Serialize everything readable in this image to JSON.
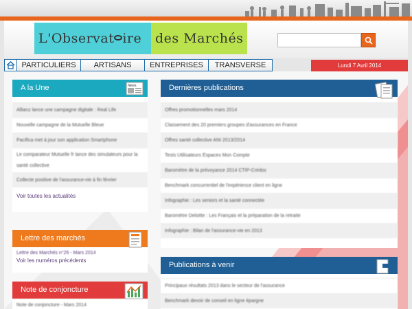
{
  "colors": {
    "accent": "#e8651d",
    "teal": "#4fd0d8",
    "lime": "#b9e24d",
    "blue": "#1f5f95",
    "red": "#e23b3b"
  },
  "header": {
    "logo_left": "L'Observat",
    "logo_left_end": "ire",
    "logo_right": "des Marchés",
    "search_placeholder": "",
    "search_icon": "search-icon",
    "date": "Lundi 7 Avril 2014"
  },
  "nav": {
    "home_icon": "home-icon",
    "tabs": [
      "PARTICULIERS",
      "ARTISANS",
      "ENTREPRISES",
      "TRANSVERSE"
    ]
  },
  "a_la_une": {
    "title": "A la Une",
    "badge": "News",
    "items": [
      "Allianz lance une campagne digitale : Real Life",
      "Nouvelle campagne de la Mutuelle Bleue",
      "Pacifica met à jour son application Smartphone",
      "Le comparateur Mutuelle fr lance des simulateurs pour la santé collective",
      "Collecte positive de l'assurance-vie à fin février"
    ],
    "more": "Voir toutes les actualités"
  },
  "lettre": {
    "title": "Lettre des marchés",
    "item": "Lettre des Marchés n°26 - Mars 2014",
    "link": "Voir les numéros précédents"
  },
  "conjoncture": {
    "title": "Note de conjoncture",
    "item": "Note de conjoncture - Mars 2014"
  },
  "publications": {
    "title": "Dernières publications",
    "items": [
      "Offres promotionnelles mars 2014",
      "Classement des 20 premiers groupes d'assurances en France",
      "Offres santé collective ANI 2013/2014",
      "Tests Utilisateurs Espaces Mon Compte",
      "Baromètre de la prévoyance 2014 CTIP-Crédoc",
      "Benchmark concurrentiel de l'expérience client en ligne",
      "Infographie : Les seniors et la santé connectée",
      "Baromètre Deloitte : Les Français et la préparation de la retraite",
      "Infographie : Bilan de l'assurance-vie en 2013"
    ]
  },
  "avenir": {
    "title": "Publications à venir",
    "items": [
      "Principaux résultats 2013 dans le secteur de l'assurance",
      "Benchmark devoir de conseil en ligne épargne"
    ]
  }
}
